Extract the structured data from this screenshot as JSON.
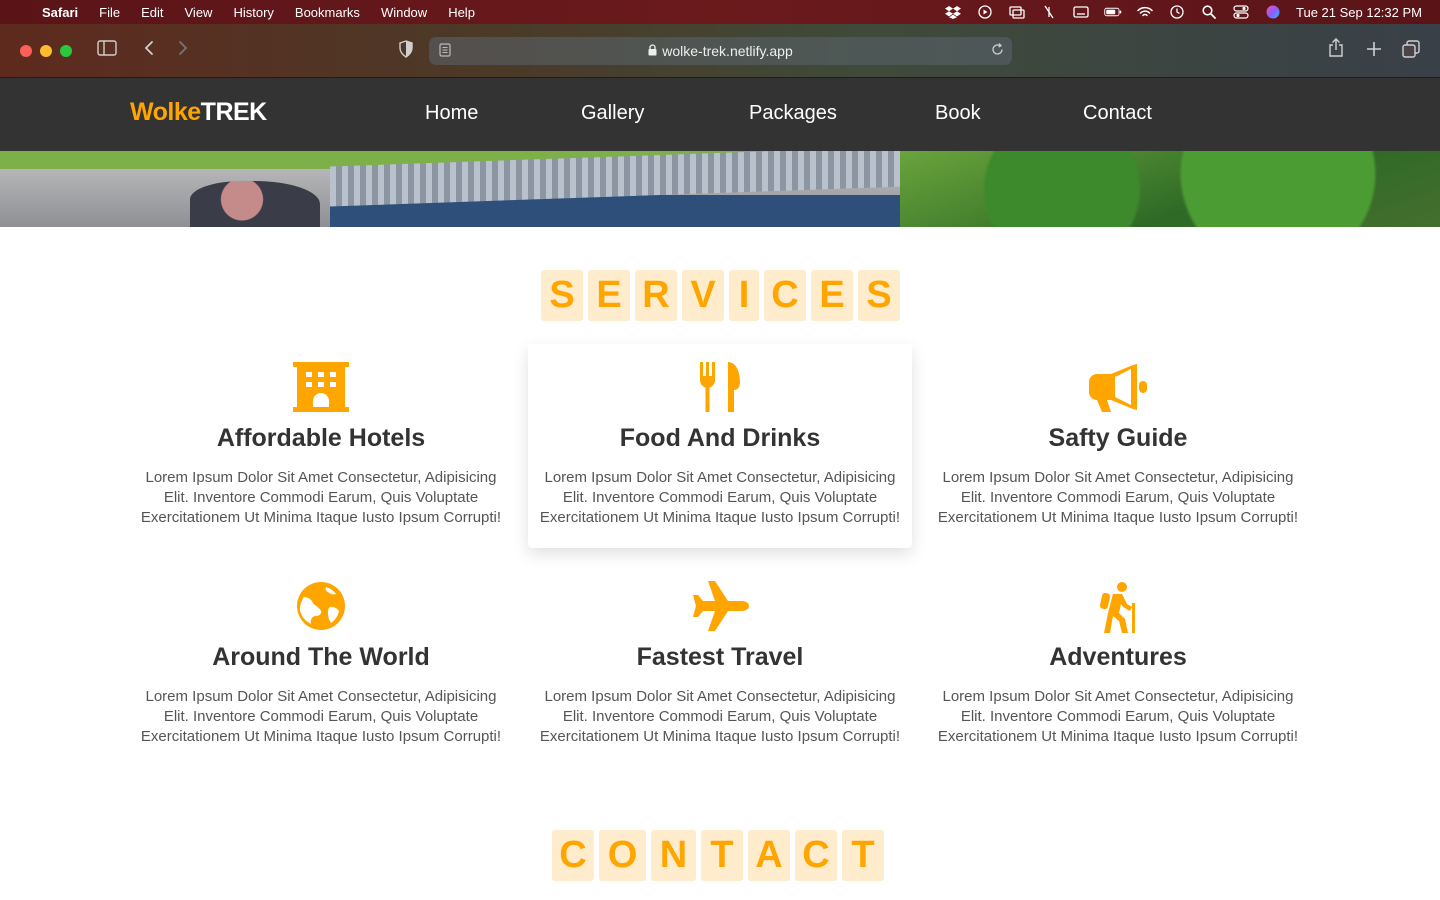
{
  "menubar": {
    "app": "Safari",
    "items": [
      "File",
      "Edit",
      "View",
      "History",
      "Bookmarks",
      "Window",
      "Help"
    ],
    "clock": "Tue 21 Sep  12:32 PM"
  },
  "browser": {
    "url": "wolke-trek.netlify.app"
  },
  "site": {
    "logo_part1": "Wolke",
    "logo_part2": "TREK",
    "nav": [
      "Home",
      "Gallery",
      "Packages",
      "Book",
      "Contact"
    ],
    "accent_color": "#ffa500"
  },
  "services": {
    "heading_letters": [
      "S",
      "E",
      "R",
      "V",
      "I",
      "C",
      "E",
      "S"
    ],
    "cards": [
      {
        "icon": "hotel-icon",
        "title": "Affordable Hotels",
        "desc": "Lorem Ipsum Dolor Sit Amet Consectetur, Adipisicing Elit. Inventore Commodi Earum, Quis Voluptate Exercitationem Ut Minima Itaque Iusto Ipsum Corrupti!"
      },
      {
        "icon": "utensils-icon",
        "title": "Food And Drinks",
        "desc": "Lorem Ipsum Dolor Sit Amet Consectetur, Adipisicing Elit. Inventore Commodi Earum, Quis Voluptate Exercitationem Ut Minima Itaque Iusto Ipsum Corrupti!"
      },
      {
        "icon": "bullhorn-icon",
        "title": "Safty Guide",
        "desc": "Lorem Ipsum Dolor Sit Amet Consectetur, Adipisicing Elit. Inventore Commodi Earum, Quis Voluptate Exercitationem Ut Minima Itaque Iusto Ipsum Corrupti!"
      },
      {
        "icon": "globe-icon",
        "title": "Around The World",
        "desc": "Lorem Ipsum Dolor Sit Amet Consectetur, Adipisicing Elit. Inventore Commodi Earum, Quis Voluptate Exercitationem Ut Minima Itaque Iusto Ipsum Corrupti!"
      },
      {
        "icon": "plane-icon",
        "title": "Fastest Travel",
        "desc": "Lorem Ipsum Dolor Sit Amet Consectetur, Adipisicing Elit. Inventore Commodi Earum, Quis Voluptate Exercitationem Ut Minima Itaque Iusto Ipsum Corrupti!"
      },
      {
        "icon": "hiking-icon",
        "title": "Adventures",
        "desc": "Lorem Ipsum Dolor Sit Amet Consectetur, Adipisicing Elit. Inventore Commodi Earum, Quis Voluptate Exercitationem Ut Minima Itaque Iusto Ipsum Corrupti!"
      }
    ]
  },
  "contact": {
    "heading_letters": [
      "C",
      "O",
      "N",
      "T",
      "A",
      "C",
      "T"
    ]
  }
}
